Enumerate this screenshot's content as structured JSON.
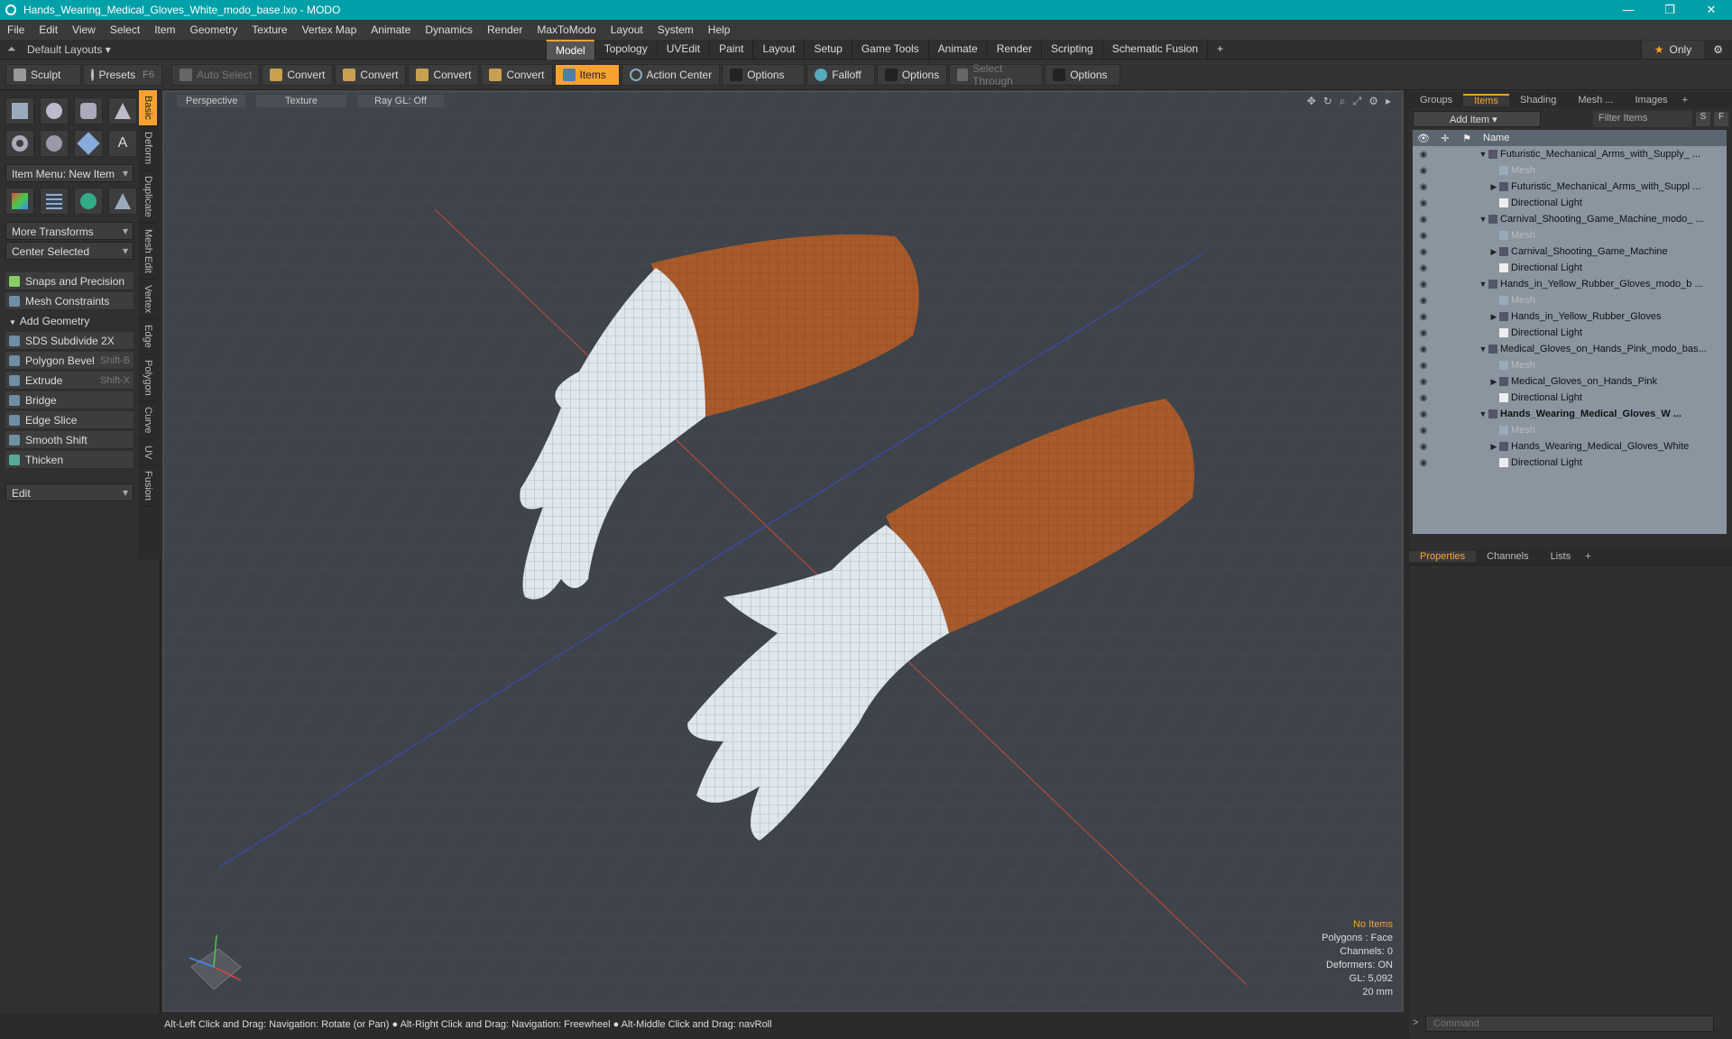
{
  "title": "Hands_Wearing_Medical_Gloves_White_modo_base.lxo - MODO",
  "window_controls": [
    "—",
    "❐",
    "✕"
  ],
  "menu": [
    "File",
    "Edit",
    "View",
    "Select",
    "Item",
    "Geometry",
    "Texture",
    "Vertex Map",
    "Animate",
    "Dynamics",
    "Render",
    "MaxToModo",
    "Layout",
    "System",
    "Help"
  ],
  "layout_selector": "Default Layouts",
  "layout_tabs": [
    "Model",
    "Topology",
    "UVEdit",
    "Paint",
    "Layout",
    "Setup",
    "Game Tools",
    "Animate",
    "Render",
    "Scripting",
    "Schematic Fusion"
  ],
  "layout_active": "Model",
  "only_label": "Only",
  "toolbar": {
    "sculpt": "Sculpt",
    "presets": "Presets",
    "presets_key": "F6",
    "auto_select": "Auto Select",
    "convert1": "Convert",
    "convert2": "Convert",
    "convert3": "Convert",
    "convert4": "Convert",
    "items": "Items",
    "action_center": "Action Center",
    "options1": "Options",
    "falloff": "Falloff",
    "options2": "Options",
    "select_through": "Select Through",
    "options3": "Options"
  },
  "vtabs": [
    "Basic",
    "Deform",
    "Duplicate",
    "Mesh Edit",
    "Vertex",
    "Edge",
    "Polygon",
    "Curve",
    "UV",
    "Fusion"
  ],
  "left": {
    "item_menu": "Item Menu: New Item",
    "more_transforms": "More Transforms",
    "center_selected": "Center Selected",
    "snaps": "Snaps and Precision",
    "mesh_constraints": "Mesh Constraints",
    "add_geometry": "Add Geometry",
    "sds": "SDS Subdivide 2X",
    "polygon_bevel": "Polygon Bevel",
    "polygon_bevel_key": "Shift-B",
    "extrude": "Extrude",
    "extrude_key": "Shift-X",
    "bridge": "Bridge",
    "edge_slice": "Edge Slice",
    "smooth_shift": "Smooth Shift",
    "thicken": "Thicken",
    "edit": "Edit"
  },
  "viewport": {
    "perspective": "Perspective",
    "texture": "Texture",
    "raygl": "Ray GL: Off",
    "info": {
      "no_items": "No Items",
      "polygons": "Polygons : Face",
      "channels": "Channels: 0",
      "deformers": "Deformers: ON",
      "gl": "GL: 5,092",
      "scale": "20 mm"
    }
  },
  "status": "Alt-Left Click and Drag: Navigation: Rotate (or Pan) ● Alt-Right Click and Drag: Navigation: Freewheel ● Alt-Middle Click and Drag: navRoll",
  "right": {
    "tabs": [
      "Groups",
      "Items",
      "Shading",
      "Mesh ...",
      "Images"
    ],
    "active_tab": "Items",
    "add_item": "Add Item",
    "filter_items": "Filter Items",
    "s_btn": "S",
    "f_btn": "F",
    "name_header": "Name",
    "rows": [
      {
        "name": "Futuristic_Mechanical_Arms_with_Supply_ ...",
        "level": 0,
        "bold": false,
        "dim": false,
        "arrow": "▼"
      },
      {
        "name": "Mesh",
        "level": 1,
        "bold": false,
        "dim": true,
        "arrow": ""
      },
      {
        "name": "Futuristic_Mechanical_Arms_with_Suppl ...",
        "level": 1,
        "bold": false,
        "dim": false,
        "arrow": "▶"
      },
      {
        "name": "Directional Light",
        "level": 1,
        "bold": false,
        "dim": false,
        "arrow": ""
      },
      {
        "name": "Carnival_Shooting_Game_Machine_modo_ ...",
        "level": 0,
        "bold": false,
        "dim": false,
        "arrow": "▼"
      },
      {
        "name": "Mesh",
        "level": 1,
        "bold": false,
        "dim": true,
        "arrow": ""
      },
      {
        "name": "Carnival_Shooting_Game_Machine",
        "level": 1,
        "bold": false,
        "dim": false,
        "arrow": "▶"
      },
      {
        "name": "Directional Light",
        "level": 1,
        "bold": false,
        "dim": false,
        "arrow": ""
      },
      {
        "name": "Hands_in_Yellow_Rubber_Gloves_modo_b ...",
        "level": 0,
        "bold": false,
        "dim": false,
        "arrow": "▼"
      },
      {
        "name": "Mesh",
        "level": 1,
        "bold": false,
        "dim": true,
        "arrow": ""
      },
      {
        "name": "Hands_in_Yellow_Rubber_Gloves",
        "level": 1,
        "bold": false,
        "dim": false,
        "arrow": "▶"
      },
      {
        "name": "Directional Light",
        "level": 1,
        "bold": false,
        "dim": false,
        "arrow": ""
      },
      {
        "name": "Medical_Gloves_on_Hands_Pink_modo_bas...",
        "level": 0,
        "bold": false,
        "dim": false,
        "arrow": "▼"
      },
      {
        "name": "Mesh",
        "level": 1,
        "bold": false,
        "dim": true,
        "arrow": ""
      },
      {
        "name": "Medical_Gloves_on_Hands_Pink",
        "level": 1,
        "bold": false,
        "dim": false,
        "arrow": "▶"
      },
      {
        "name": "Directional Light",
        "level": 1,
        "bold": false,
        "dim": false,
        "arrow": ""
      },
      {
        "name": "Hands_Wearing_Medical_Gloves_W ...",
        "level": 0,
        "bold": true,
        "dim": false,
        "arrow": "▼"
      },
      {
        "name": "Mesh",
        "level": 1,
        "bold": false,
        "dim": true,
        "arrow": ""
      },
      {
        "name": "Hands_Wearing_Medical_Gloves_White",
        "level": 1,
        "bold": false,
        "dim": false,
        "arrow": "▶"
      },
      {
        "name": "Directional Light",
        "level": 1,
        "bold": false,
        "dim": false,
        "arrow": ""
      }
    ],
    "prop_tabs": [
      "Properties",
      "Channels",
      "Lists"
    ],
    "prop_active": "Properties",
    "command_placeholder": "Command"
  },
  "colors": {
    "accent": "#f7a230",
    "titlebar": "#00a0a8",
    "glove": "#dfe6ec",
    "sleeve": "#a85a2a"
  }
}
